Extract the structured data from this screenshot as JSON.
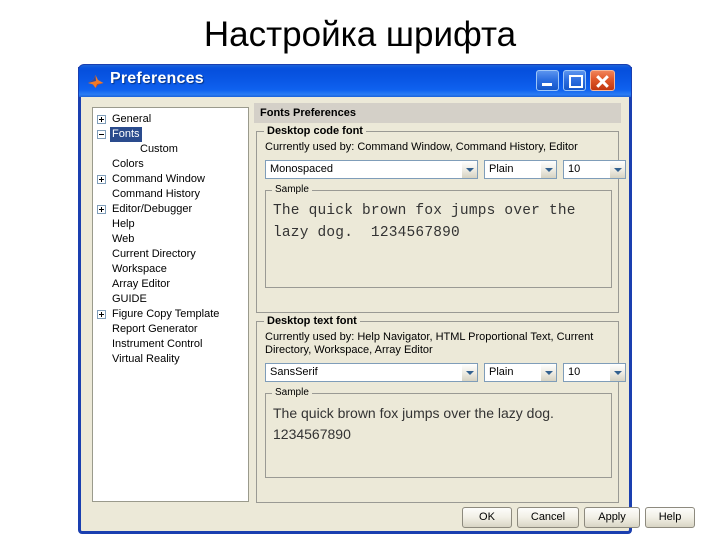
{
  "slide": {
    "heading": "Настройка шрифта"
  },
  "window": {
    "title": "Preferences",
    "icon": "matlab-membrane-icon",
    "controls": {
      "minimize": "Minimize",
      "maximize": "Maximize",
      "close": "Close"
    }
  },
  "tree": {
    "items": [
      {
        "label": "General",
        "level": 0,
        "expander": "plus",
        "selected": false
      },
      {
        "label": "Fonts",
        "level": 0,
        "expander": "minus",
        "selected": true
      },
      {
        "label": "Custom",
        "level": 1,
        "expander": "none",
        "selected": false
      },
      {
        "label": "Colors",
        "level": 0,
        "expander": "none",
        "selected": false
      },
      {
        "label": "Command Window",
        "level": 0,
        "expander": "plus",
        "selected": false
      },
      {
        "label": "Command History",
        "level": 0,
        "expander": "none",
        "selected": false
      },
      {
        "label": "Editor/Debugger",
        "level": 0,
        "expander": "plus",
        "selected": false
      },
      {
        "label": "Help",
        "level": 0,
        "expander": "none",
        "selected": false
      },
      {
        "label": "Web",
        "level": 0,
        "expander": "none",
        "selected": false
      },
      {
        "label": "Current Directory",
        "level": 0,
        "expander": "none",
        "selected": false
      },
      {
        "label": "Workspace",
        "level": 0,
        "expander": "none",
        "selected": false
      },
      {
        "label": "Array Editor",
        "level": 0,
        "expander": "none",
        "selected": false
      },
      {
        "label": "GUIDE",
        "level": 0,
        "expander": "none",
        "selected": false
      },
      {
        "label": "Figure Copy Template",
        "level": 0,
        "expander": "plus",
        "selected": false
      },
      {
        "label": "Report Generator",
        "level": 0,
        "expander": "none",
        "selected": false
      },
      {
        "label": "Instrument Control",
        "level": 0,
        "expander": "none",
        "selected": false
      },
      {
        "label": "Virtual Reality",
        "level": 0,
        "expander": "none",
        "selected": false
      }
    ]
  },
  "pane": {
    "header": "Fonts Preferences",
    "code_font": {
      "group_title": "Desktop code font",
      "used_by": "Currently used by: Command Window, Command History, Editor",
      "family": "Monospaced",
      "style": "Plain",
      "size": "10",
      "sample_title": "Sample",
      "sample_text": "The quick brown fox jumps over the lazy dog.  1234567890"
    },
    "text_font": {
      "group_title": "Desktop text font",
      "used_by": "Currently used by: Help Navigator, HTML Proportional Text, Current Directory, Workspace, Array Editor",
      "family": "SansSerif",
      "style": "Plain",
      "size": "10",
      "sample_title": "Sample",
      "sample_text": "The quick brown fox jumps over the lazy dog. 1234567890"
    }
  },
  "buttons": {
    "ok": "OK",
    "cancel": "Cancel",
    "apply": "Apply",
    "help": "Help"
  },
  "colors": {
    "titlebar_blue": "#0a54e0",
    "window_border": "#1a3fb0",
    "dialog_face": "#ece9d8",
    "pane_header": "#d4d0c8",
    "selection_blue": "#2a4b8d",
    "close_red": "#e15a2b"
  }
}
